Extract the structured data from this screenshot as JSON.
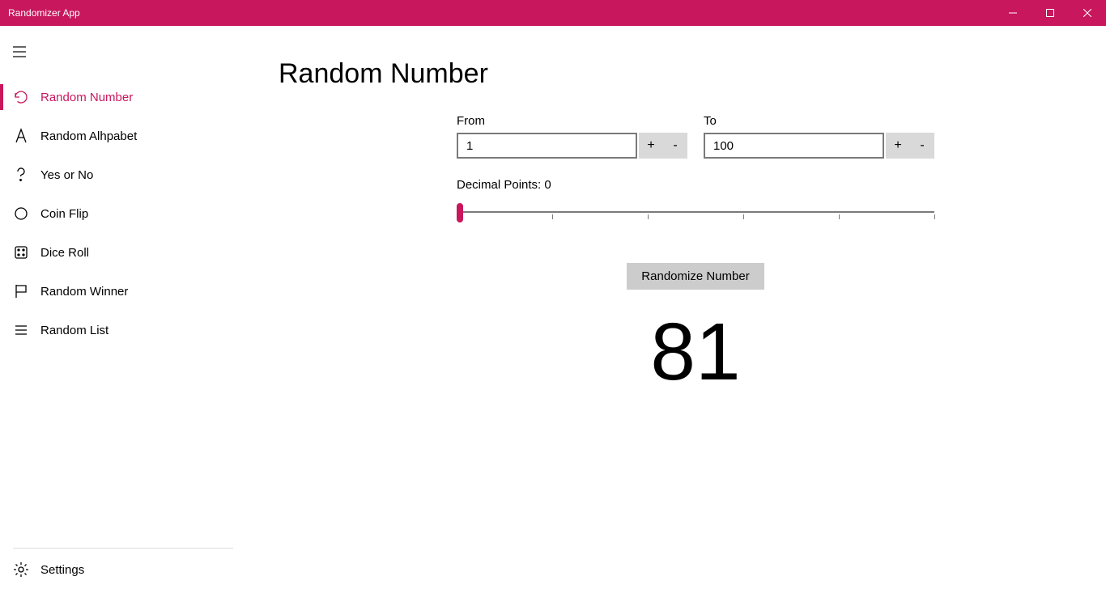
{
  "window": {
    "title": "Randomizer App"
  },
  "sidebar": {
    "items": [
      {
        "label": "Random Number"
      },
      {
        "label": "Random Alhpabet"
      },
      {
        "label": "Yes or No"
      },
      {
        "label": "Coin Flip"
      },
      {
        "label": "Dice Roll"
      },
      {
        "label": "Random Winner"
      },
      {
        "label": "Random List"
      }
    ],
    "settings_label": "Settings"
  },
  "main": {
    "title": "Random Number",
    "from_label": "From",
    "to_label": "To",
    "from_value": "1",
    "to_value": "100",
    "decimal_label": "Decimal Points: 0",
    "randomize_label": "Randomize Number",
    "result": "81",
    "plus": "+",
    "minus": "-"
  },
  "colors": {
    "accent": "#c8175d"
  }
}
